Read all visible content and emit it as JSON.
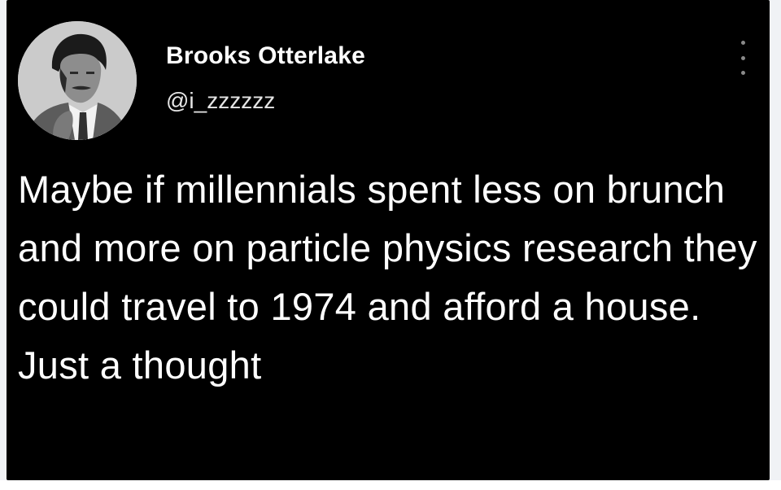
{
  "tweet": {
    "author_name": "Brooks Otterlake",
    "author_handle": "@i_zzzzzz",
    "text": "Maybe if millennials spent less on brunch and more on particle physics research they could travel to 1974 and afford a house. Just a thought",
    "more_icon": "more-vertical-icon"
  },
  "colors": {
    "background": "#000000",
    "name_text": "#ffffff",
    "handle_text": "#e6e6e6",
    "tweet_text": "#ffffff",
    "icon": "#8a8a8a"
  }
}
